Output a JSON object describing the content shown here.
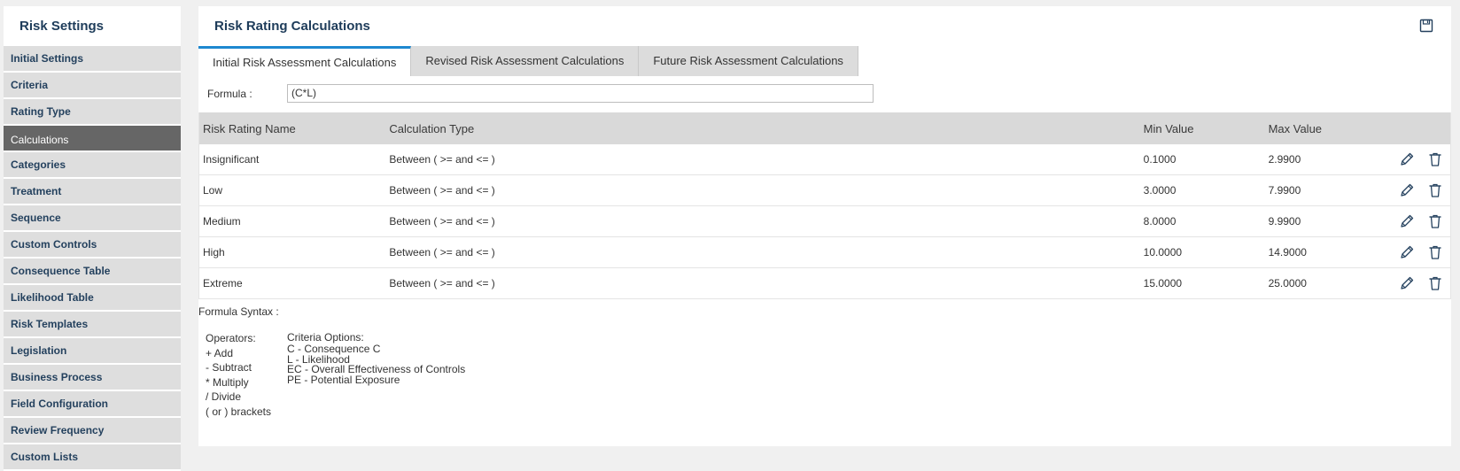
{
  "sidebar": {
    "title": "Risk Settings",
    "items": [
      {
        "label": "Initial Settings"
      },
      {
        "label": "Criteria"
      },
      {
        "label": "Rating Type"
      },
      {
        "label": "Calculations"
      },
      {
        "label": "Categories"
      },
      {
        "label": "Treatment"
      },
      {
        "label": "Sequence"
      },
      {
        "label": "Custom Controls"
      },
      {
        "label": "Consequence Table"
      },
      {
        "label": "Likelihood Table"
      },
      {
        "label": "Risk Templates"
      },
      {
        "label": "Legislation"
      },
      {
        "label": "Business Process"
      },
      {
        "label": "Field Configuration"
      },
      {
        "label": "Review Frequency"
      },
      {
        "label": "Custom Lists"
      }
    ],
    "active_index": 3
  },
  "main": {
    "title": "Risk Rating Calculations",
    "save_icon": "save-icon",
    "tabs": [
      {
        "label": "Initial Risk Assessment Calculations"
      },
      {
        "label": "Revised Risk Assessment Calculations"
      },
      {
        "label": "Future Risk Assessment Calculations"
      }
    ],
    "active_tab": 0,
    "formula": {
      "label": "Formula :",
      "value": "(C*L)"
    },
    "table": {
      "headers": [
        "Risk Rating Name",
        "Calculation Type",
        "Min Value",
        "Max Value"
      ],
      "rows": [
        {
          "name": "Insignificant",
          "type": "Between ( >= and <= )",
          "min": "0.1000",
          "max": "2.9900"
        },
        {
          "name": "Low",
          "type": "Between ( >= and <= )",
          "min": "3.0000",
          "max": "7.9900"
        },
        {
          "name": "Medium",
          "type": "Between ( >= and <= )",
          "min": "8.0000",
          "max": "9.9900"
        },
        {
          "name": "High",
          "type": "Between ( >= and <= )",
          "min": "10.0000",
          "max": "14.9000"
        },
        {
          "name": "Extreme",
          "type": "Between ( >= and <= )",
          "min": "15.0000",
          "max": "25.0000"
        }
      ]
    },
    "syntax": {
      "title": "Formula Syntax :",
      "operators_title": "Operators:",
      "operators": [
        "+ Add",
        "- Subtract",
        "* Multiply",
        "/ Divide",
        "( or ) brackets"
      ],
      "criteria_title": "Criteria Options:",
      "criteria": [
        "C - Consequence C",
        "L - Likelihood",
        "EC - Overall Effectiveness of Controls",
        "PE - Potential Exposure"
      ]
    }
  },
  "colors": {
    "accent": "#1e88d0",
    "title": "#1e3c5a",
    "active_side": "#666666"
  }
}
